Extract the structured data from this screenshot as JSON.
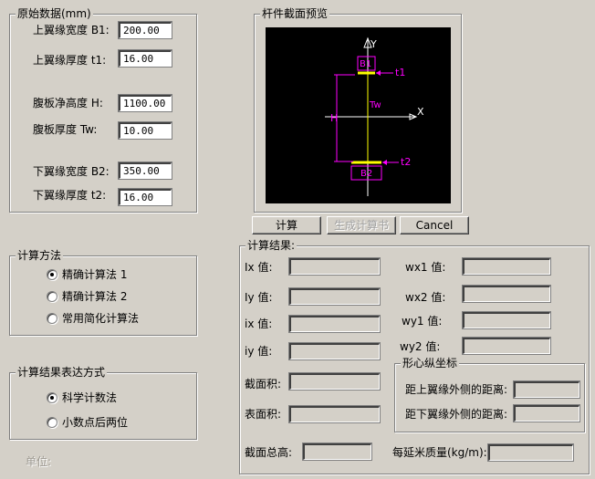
{
  "input_group": {
    "title": "原始数据(mm)",
    "fields": [
      {
        "label": "上翼缘宽度 B1:",
        "value": "200.00"
      },
      {
        "label": "上翼缘厚度 t1:",
        "value": "16.00"
      },
      {
        "label": "腹板净高度 H:",
        "value": "1100.00"
      },
      {
        "label": "腹板厚度 Tw:",
        "value": "10.00"
      },
      {
        "label": "下翼缘宽度 B2:",
        "value": "350.00"
      },
      {
        "label": "下翼缘厚度 t2:",
        "value": "16.00"
      }
    ]
  },
  "preview_group": {
    "title": "杆件截面预览",
    "labels": {
      "y": "Y",
      "x": "X",
      "b1": "B1",
      "t1": "t1",
      "tw": "Tw",
      "h": "H",
      "t2": "t2",
      "b2": "B2"
    }
  },
  "buttons": {
    "calc": "计算",
    "report": "生成计算书",
    "cancel": "Cancel"
  },
  "method_group": {
    "title": "计算方法",
    "options": [
      "精确计算法 1",
      "精确计算法 2",
      "常用简化计算法"
    ],
    "selected": 0
  },
  "format_group": {
    "title": "计算结果表达方式",
    "options": [
      "科学计数法",
      "小数点后两位"
    ],
    "selected": 0
  },
  "unit_label": "单位:",
  "results_group": {
    "title": "计算结果:",
    "left": [
      {
        "label": "Ix 值:",
        "value": ""
      },
      {
        "label": "Iy 值:",
        "value": ""
      },
      {
        "label": "ix 值:",
        "value": ""
      },
      {
        "label": "iy 值:",
        "value": ""
      },
      {
        "label": "截面积:",
        "value": ""
      },
      {
        "label": "表面积:",
        "value": ""
      }
    ],
    "right": [
      {
        "label": "wx1 值:",
        "value": ""
      },
      {
        "label": "wx2 值:",
        "value": ""
      },
      {
        "label": "wy1 值:",
        "value": ""
      },
      {
        "label": "wy2 值:",
        "value": ""
      }
    ],
    "centroid": {
      "title": "形心纵坐标",
      "top_label": "距上翼缘外侧的距离:",
      "top_value": "",
      "bottom_label": "距下翼缘外侧的距离:",
      "bottom_value": ""
    },
    "total_height_label": "截面总高:",
    "total_height_value": "",
    "mass_label": "每延米质量(kg/m):",
    "mass_value": ""
  },
  "colors": {
    "beam": "#ffff00",
    "dimension": "#ff00ff",
    "axis": "#ffffff",
    "background": "#000000"
  }
}
